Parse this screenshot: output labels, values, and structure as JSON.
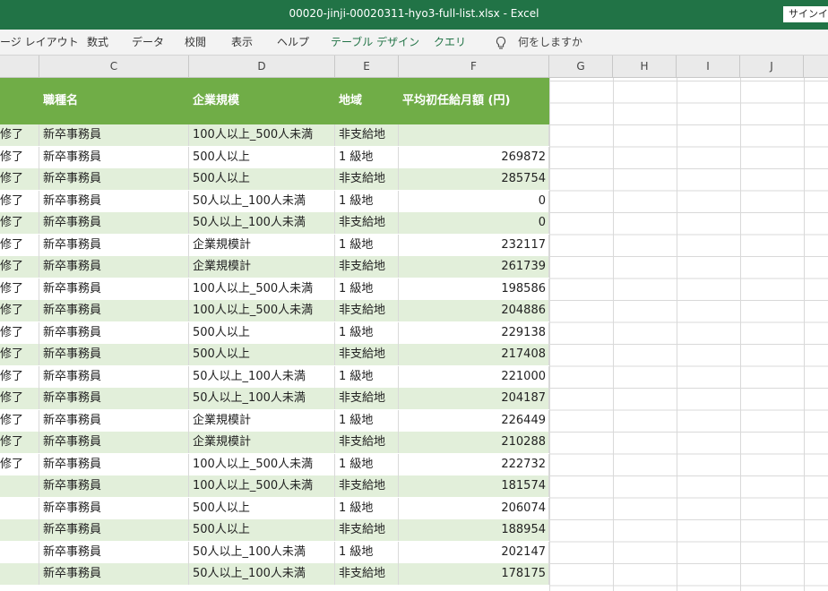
{
  "window": {
    "title": "00020-jinji-00020311-hyo3-full-list.xlsx  -  Excel",
    "signin_label": "サインイン"
  },
  "ribbon": {
    "tabs": [
      "ージ レイアウト",
      "数式",
      "データ",
      "校閲",
      "表示",
      "ヘルプ",
      "テーブル デザイン",
      "クエリ"
    ],
    "tell_me": "何をしますか"
  },
  "columns": [
    "C",
    "D",
    "E",
    "F",
    "G",
    "H",
    "I",
    "J"
  ],
  "table": {
    "headers": [
      "職種名",
      "企業規模",
      "地域",
      "平均初任給月額 (円)"
    ],
    "rows": [
      {
        "stub": "修了",
        "job": "新卒事務員",
        "size": "100人以上_500人未満",
        "region": "非支給地",
        "salary": ""
      },
      {
        "stub": "修了",
        "job": "新卒事務員",
        "size": "500人以上",
        "region": "1 級地",
        "salary": "269872"
      },
      {
        "stub": "修了",
        "job": "新卒事務員",
        "size": "500人以上",
        "region": "非支給地",
        "salary": "285754"
      },
      {
        "stub": "修了",
        "job": "新卒事務員",
        "size": "50人以上_100人未満",
        "region": "1 級地",
        "salary": "0"
      },
      {
        "stub": "修了",
        "job": "新卒事務員",
        "size": "50人以上_100人未満",
        "region": "非支給地",
        "salary": "0"
      },
      {
        "stub": "修了",
        "job": "新卒事務員",
        "size": "企業規模計",
        "region": "1 級地",
        "salary": "232117"
      },
      {
        "stub": "修了",
        "job": "新卒事務員",
        "size": "企業規模計",
        "region": "非支給地",
        "salary": "261739"
      },
      {
        "stub": "修了",
        "job": "新卒事務員",
        "size": "100人以上_500人未満",
        "region": "1 級地",
        "salary": "198586"
      },
      {
        "stub": "修了",
        "job": "新卒事務員",
        "size": "100人以上_500人未満",
        "region": "非支給地",
        "salary": "204886"
      },
      {
        "stub": "修了",
        "job": "新卒事務員",
        "size": "500人以上",
        "region": "1 級地",
        "salary": "229138"
      },
      {
        "stub": "修了",
        "job": "新卒事務員",
        "size": "500人以上",
        "region": "非支給地",
        "salary": "217408"
      },
      {
        "stub": "修了",
        "job": "新卒事務員",
        "size": "50人以上_100人未満",
        "region": "1 級地",
        "salary": "221000"
      },
      {
        "stub": "修了",
        "job": "新卒事務員",
        "size": "50人以上_100人未満",
        "region": "非支給地",
        "salary": "204187"
      },
      {
        "stub": "修了",
        "job": "新卒事務員",
        "size": "企業規模計",
        "region": "1 級地",
        "salary": "226449"
      },
      {
        "stub": "修了",
        "job": "新卒事務員",
        "size": "企業規模計",
        "region": "非支給地",
        "salary": "210288"
      },
      {
        "stub": "修了",
        "job": "新卒事務員",
        "size": "100人以上_500人未満",
        "region": "1 級地",
        "salary": "222732"
      },
      {
        "stub": "",
        "job": "新卒事務員",
        "size": "100人以上_500人未満",
        "region": "非支給地",
        "salary": "181574"
      },
      {
        "stub": "",
        "job": "新卒事務員",
        "size": "500人以上",
        "region": "1 級地",
        "salary": "206074"
      },
      {
        "stub": "",
        "job": "新卒事務員",
        "size": "500人以上",
        "region": "非支給地",
        "salary": "188954"
      },
      {
        "stub": "",
        "job": "新卒事務員",
        "size": "50人以上_100人未満",
        "region": "1 級地",
        "salary": "202147"
      },
      {
        "stub": "",
        "job": "新卒事務員",
        "size": "50人以上_100人未満",
        "region": "非支給地",
        "salary": "178175"
      }
    ]
  },
  "colors": {
    "title_bar": "#217346",
    "table_header": "#70ad47",
    "band": "#e2efda",
    "context_tab": "#217346"
  }
}
